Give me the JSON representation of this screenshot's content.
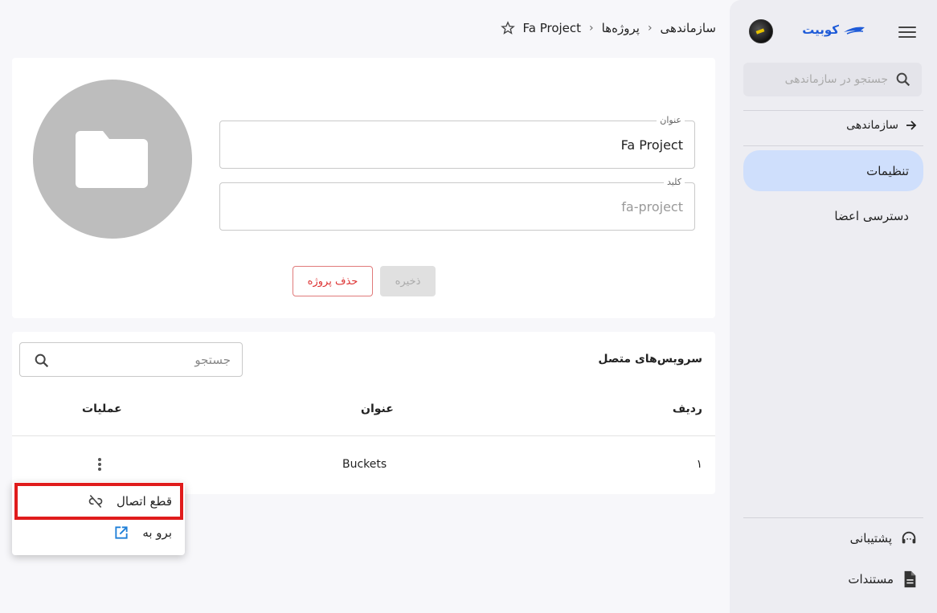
{
  "sidebar": {
    "brand_name": "کوبیت",
    "search_placeholder": "جستجو در سازماندهی",
    "org_link": "سازماندهی",
    "items": [
      {
        "label": "تنظیمات"
      },
      {
        "label": "دسترسی اعضا"
      }
    ],
    "support": "پشتیبانی",
    "docs": "مستندات"
  },
  "breadcrumb": {
    "org": "سازماندهی",
    "projects": "پروژه‌ها",
    "current": "Fa Project"
  },
  "project_form": {
    "title_label": "عنوان",
    "title_value": "Fa Project",
    "key_label": "کلید",
    "key_value": "fa-project",
    "save_label": "ذخیره",
    "delete_label": "حذف پروژه"
  },
  "services": {
    "title": "سرویس‌های متصل",
    "search_placeholder": "جستجو",
    "headers": {
      "row": "ردیف",
      "title": "عنوان",
      "actions": "عملیات"
    },
    "rows": [
      {
        "index": "۱",
        "title": "Buckets"
      }
    ]
  },
  "context_menu": {
    "disconnect": "قطع اتصال",
    "goto": "برو به"
  },
  "colors": {
    "accent": "#1e5bd8",
    "active_item_bg": "#cfdffc",
    "danger": "#dd3333",
    "highlight": "#e01c1c"
  }
}
